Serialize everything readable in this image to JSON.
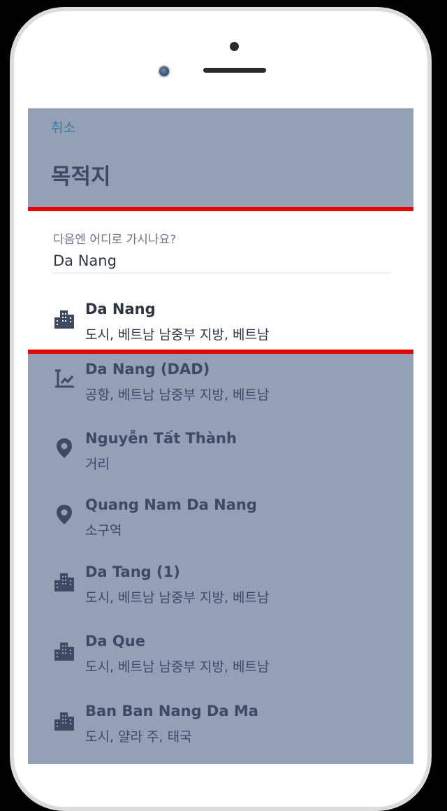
{
  "header": {
    "cancel_label": "취소",
    "title": "목적지"
  },
  "search": {
    "label": "다음엔 어디로 가시나요?",
    "value": "Da Nang"
  },
  "results": [
    {
      "icon": "city-icon",
      "name": "Da Nang",
      "sub": "도시, 베트남 남중부 지방, 베트남",
      "selected": true
    },
    {
      "icon": "airport-icon",
      "name": "Da Nang (DAD)",
      "sub": "공항, 베트남 남중부 지방, 베트남"
    },
    {
      "icon": "location-pin-icon",
      "name": "Nguyễn Tất Thành",
      "sub": "거리"
    },
    {
      "icon": "location-pin-icon",
      "name": "Quang Nam Da Nang",
      "sub": "소구역"
    },
    {
      "icon": "city-icon",
      "name": "Da Tang (1)",
      "sub": "도시, 베트남 남중부 지방, 베트남"
    },
    {
      "icon": "city-icon",
      "name": "Da Que",
      "sub": "도시, 베트남 남중부 지방, 베트남"
    },
    {
      "icon": "city-icon",
      "name": "Ban Ban Nang Da Ma",
      "sub": "도시, 얄라 주, 태국"
    }
  ],
  "colors": {
    "overlay": "#93a0b6",
    "highlight_border": "#f00000",
    "accent": "#2f7fa6",
    "text": "#3e4a62"
  }
}
